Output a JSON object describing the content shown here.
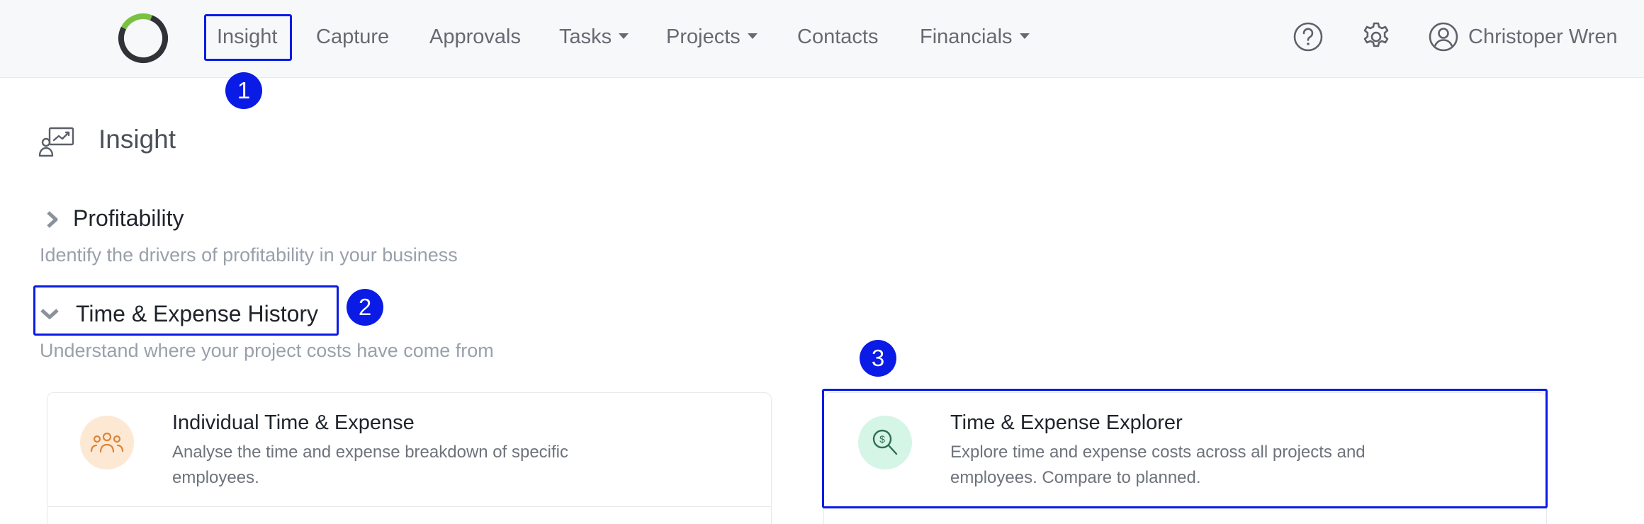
{
  "nav": {
    "items": [
      {
        "label": "Insight",
        "has_dropdown": false
      },
      {
        "label": "Capture",
        "has_dropdown": false
      },
      {
        "label": "Approvals",
        "has_dropdown": false
      },
      {
        "label": "Tasks",
        "has_dropdown": true
      },
      {
        "label": "Projects",
        "has_dropdown": true
      },
      {
        "label": "Contacts",
        "has_dropdown": false
      },
      {
        "label": "Financials",
        "has_dropdown": true
      }
    ],
    "user": {
      "name": "Christoper Wren",
      "has_dropdown": true
    },
    "icons": [
      "help-circle-icon",
      "gear-icon",
      "user-circle-icon"
    ]
  },
  "page": {
    "title": "Insight",
    "icon": "presentation-user-icon"
  },
  "sections": [
    {
      "title": "Profitability",
      "description": "Identify the drivers of profitability in your business",
      "expanded": false
    },
    {
      "title": "Time & Expense History",
      "description": "Understand where your project costs have come from",
      "expanded": true
    }
  ],
  "cards": [
    {
      "title": "Individual Time & Expense",
      "description": "Analyse the time and expense breakdown of specific employees.",
      "icon": "people-group-icon"
    },
    {
      "title": "Time & Expense Explorer",
      "description": "Explore time and expense costs across all projects and employees. Compare to planned.",
      "icon": "dollar-search-icon"
    }
  ],
  "annotations": {
    "badges": [
      "1",
      "2",
      "3"
    ]
  },
  "colors": {
    "accent_highlight": "#0a1be6",
    "logo_dark": "#2f3338",
    "logo_green": "#7ac143",
    "card1_icon_bg": "#fde9d3",
    "card1_icon": "#d9853b",
    "card2_icon_bg": "#d5f5e6",
    "card2_icon": "#2f6e55"
  }
}
